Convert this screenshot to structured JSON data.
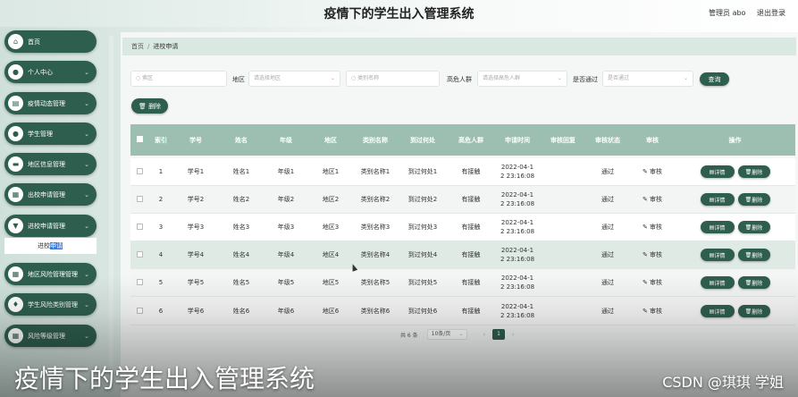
{
  "app": {
    "title": "疫情下的学生出入管理系统",
    "user": "管理员 abo",
    "logout": "退出登录"
  },
  "sidebar": {
    "items": [
      {
        "label": "首页",
        "icon": "home-icon",
        "glyph": "⌂",
        "chevron": false
      },
      {
        "label": "个人中心",
        "icon": "user-icon",
        "glyph": "●",
        "chevron": true
      },
      {
        "label": "疫情动态管理",
        "icon": "doc-icon",
        "glyph": "▤",
        "chevron": true
      },
      {
        "label": "学生管理",
        "icon": "person-icon",
        "glyph": "●",
        "chevron": true
      },
      {
        "label": "地区信息管理",
        "icon": "building-icon",
        "glyph": "▬",
        "chevron": true
      },
      {
        "label": "出校申请管理",
        "icon": "grid-icon",
        "glyph": "▦",
        "chevron": true
      },
      {
        "label": "进校申请管理",
        "icon": "shield-icon",
        "glyph": "▼",
        "chevron": true
      },
      {
        "label": "地区风险管理管理",
        "icon": "grid-icon",
        "glyph": "▦",
        "chevron": true
      },
      {
        "label": "学生风险类别管理",
        "icon": "bulb-icon",
        "glyph": "♦",
        "chevron": true
      },
      {
        "label": "风险等级管理",
        "icon": "grid-icon",
        "glyph": "▦",
        "chevron": true
      }
    ],
    "submenu": {
      "prefix": "进校",
      "highlight": "申请"
    }
  },
  "breadcrumb": {
    "home": "首页",
    "sep": "/",
    "current": "进校申请"
  },
  "filters": {
    "index_placeholder": "○ 索区",
    "region_label": "地区",
    "region_placeholder": "请选择地区",
    "category_placeholder": "○ 类别名称",
    "contact_label": "高危人群",
    "contact_placeholder": "请选择高危人群",
    "approved_label": "是否通过",
    "approved_placeholder": "是否通过",
    "query": "查询"
  },
  "actions": {
    "delete": "删除"
  },
  "table": {
    "headers": [
      "索引",
      "学号",
      "姓名",
      "年级",
      "地区",
      "类别名称",
      "到过何处",
      "高危人群",
      "申请时间",
      "审核回复",
      "审核状态",
      "审核",
      "操作"
    ],
    "rows": [
      {
        "index": "1",
        "sno": "学号1",
        "name": "姓名1",
        "grade": "年级1",
        "region": "地区1",
        "category": "类别名称1",
        "place": "到过何处1",
        "contact": "有接触",
        "time1": "2022-04-1",
        "time2": "2 23:16:08",
        "reply": "",
        "status": "通过",
        "review": "审核"
      },
      {
        "index": "2",
        "sno": "学号2",
        "name": "姓名2",
        "grade": "年级2",
        "region": "地区2",
        "category": "类别名称2",
        "place": "到过何处2",
        "contact": "有接触",
        "time1": "2022-04-1",
        "time2": "2 23:16:08",
        "reply": "",
        "status": "通过",
        "review": "审核"
      },
      {
        "index": "3",
        "sno": "学号3",
        "name": "姓名3",
        "grade": "年级3",
        "region": "地区3",
        "category": "类别名称3",
        "place": "到过何处3",
        "contact": "有接触",
        "time1": "2022-04-1",
        "time2": "2 23:16:08",
        "reply": "",
        "status": "通过",
        "review": "审核"
      },
      {
        "index": "4",
        "sno": "学号4",
        "name": "姓名4",
        "grade": "年级4",
        "region": "地区4",
        "category": "类别名称4",
        "place": "到过何处4",
        "contact": "有接触",
        "time1": "2022-04-1",
        "time2": "2 23:16:08",
        "reply": "",
        "status": "通过",
        "review": "审核"
      },
      {
        "index": "5",
        "sno": "学号5",
        "name": "姓名5",
        "grade": "年级5",
        "region": "地区5",
        "category": "类别名称5",
        "place": "到过何处5",
        "contact": "有接触",
        "time1": "2022-04-1",
        "time2": "2 23:16:08",
        "reply": "",
        "status": "通过",
        "review": "审核"
      },
      {
        "index": "6",
        "sno": "学号6",
        "name": "姓名6",
        "grade": "年级6",
        "region": "地区6",
        "category": "类别名称6",
        "place": "到过何处6",
        "contact": "有接触",
        "time1": "2022-04-1",
        "time2": "2 23:16:08",
        "reply": "",
        "status": "通过",
        "review": "审核"
      }
    ],
    "op_detail": "详情",
    "op_delete": "删除"
  },
  "pager": {
    "total": "共 6 条",
    "size": "10条/页",
    "current": "1",
    "prev": "‹",
    "next": "›"
  },
  "overlay": {
    "title": "疫情下的学生出入管理系统",
    "watermark": "CSDN @琪琪 学姐"
  },
  "colors": {
    "accent": "#2e5e4e",
    "header": "#9cbfb1",
    "status": "#4f8f74"
  }
}
